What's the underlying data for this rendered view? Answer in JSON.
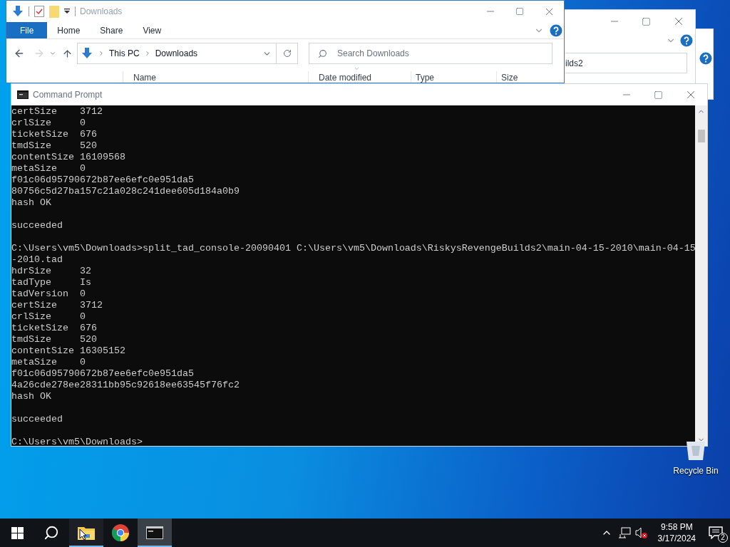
{
  "explorer": {
    "title": "Downloads",
    "ribbon_tabs": [
      {
        "label": "File",
        "selected": true
      },
      {
        "label": "Home",
        "selected": false
      },
      {
        "label": "Share",
        "selected": false
      },
      {
        "label": "View",
        "selected": false
      }
    ],
    "nav": [
      {
        "kind": "back",
        "disabled": false
      },
      {
        "kind": "forward",
        "disabled": true
      }
    ],
    "breadcrumb": [
      "This PC",
      "Downloads"
    ],
    "search": {
      "placeholder": "Search Downloads"
    },
    "columns": [
      "Name",
      "Date modified",
      "Type",
      "Size"
    ]
  },
  "explorer_back": {
    "address": "ilds2"
  },
  "cmd": {
    "title": "Command Prompt",
    "lines": [
      {
        "kind": "output",
        "text": "certSize    3712"
      },
      {
        "kind": "output",
        "text": "crlSize     0"
      },
      {
        "kind": "output",
        "text": "ticketSize  676"
      },
      {
        "kind": "output",
        "text": "tmdSize     520"
      },
      {
        "kind": "output",
        "text": "contentSize 16109568"
      },
      {
        "kind": "output",
        "text": "metaSize    0"
      },
      {
        "kind": "output",
        "text": "f01c06d95790672b87ee6efc0e951da5"
      },
      {
        "kind": "output",
        "text": "80756c5d27ba157c21a028c241dee605d184a0b9"
      },
      {
        "kind": "output",
        "text": "hash OK"
      },
      {
        "kind": "blank"
      },
      {
        "kind": "output",
        "text": "succeeded"
      },
      {
        "kind": "blank"
      },
      {
        "kind": "output",
        "text": "C:\\Users\\vm5\\Downloads>split_tad_console-20090401 C:\\Users\\vm5\\Downloads\\RiskysRevengeBuilds2\\main-04-15-2010\\main-04-15"
      },
      {
        "kind": "output",
        "text": "-2010.tad"
      },
      {
        "kind": "output",
        "text": "hdrSize     32"
      },
      {
        "kind": "output",
        "text": "tadType     Is"
      },
      {
        "kind": "output",
        "text": "tadVersion  0"
      },
      {
        "kind": "output",
        "text": "certSize    3712"
      },
      {
        "kind": "output",
        "text": "crlSize     0"
      },
      {
        "kind": "output",
        "text": "ticketSize  676"
      },
      {
        "kind": "output",
        "text": "tmdSize     520"
      },
      {
        "kind": "output",
        "text": "contentSize 16305152"
      },
      {
        "kind": "output",
        "text": "metaSize    0"
      },
      {
        "kind": "output",
        "text": "f01c06d95790672b87ee6efc0e951da5"
      },
      {
        "kind": "output",
        "text": "4a26cde278ee28311bb95c92618ee63545f76fc2"
      },
      {
        "kind": "output",
        "text": "hash OK"
      },
      {
        "kind": "blank"
      },
      {
        "kind": "output",
        "text": "succeeded"
      },
      {
        "kind": "blank"
      },
      {
        "kind": "output",
        "text": "C:\\Users\\vm5\\Downloads>"
      }
    ]
  },
  "desktop_icons": [
    {
      "label": "Recycle Bin"
    }
  ],
  "taskbar": {
    "apps": [
      {
        "kind": "explorer",
        "open": true,
        "selected": false
      },
      {
        "kind": "chrome",
        "open": false,
        "selected": false
      },
      {
        "kind": "terminal",
        "open": true,
        "selected": true
      }
    ],
    "time": "9:58 PM",
    "date": "3/17/2024",
    "notifications": "2"
  }
}
